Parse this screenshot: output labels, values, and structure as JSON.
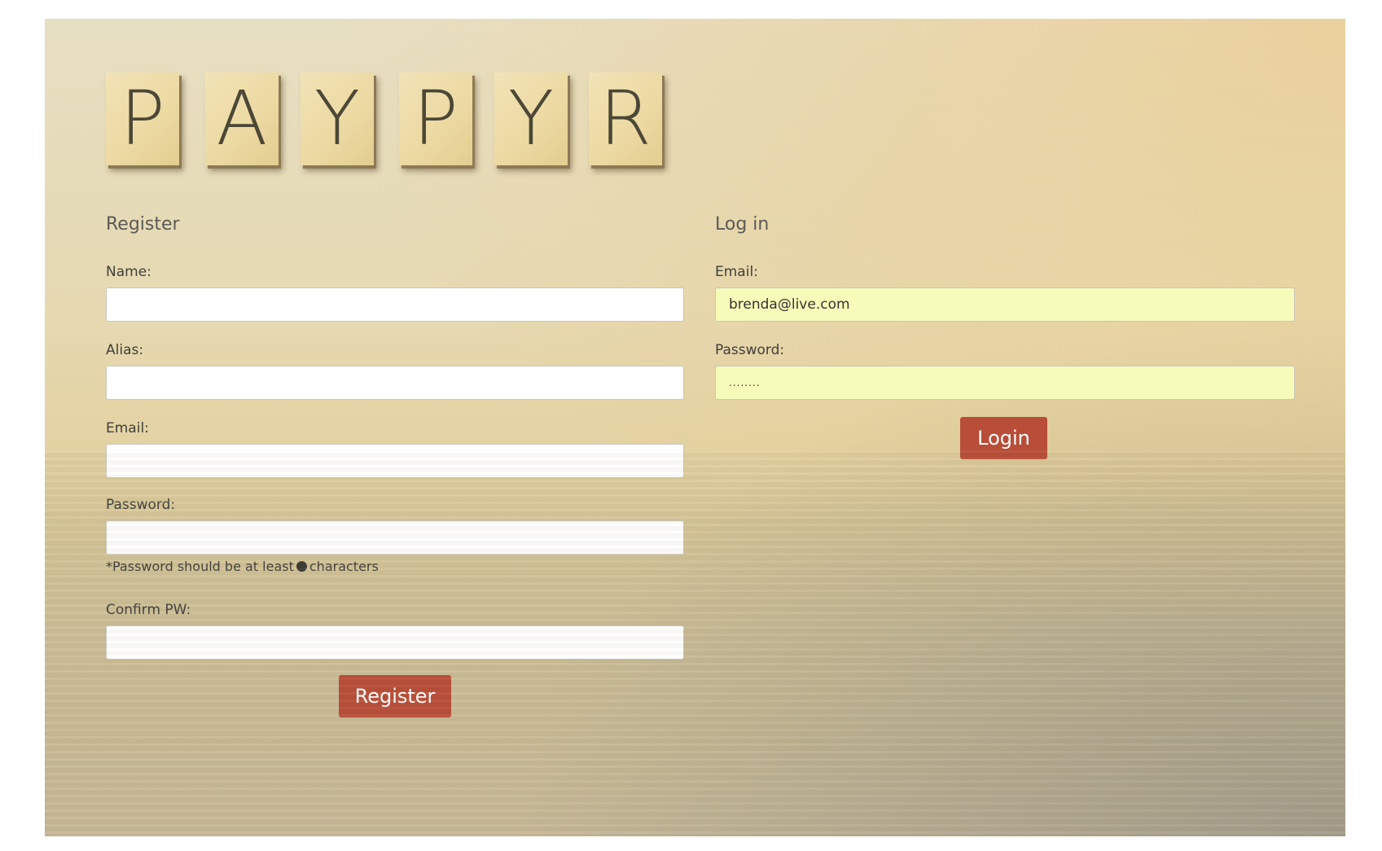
{
  "logo": {
    "letters": [
      "P",
      "A",
      "Y",
      "P",
      "Y",
      "R"
    ]
  },
  "register": {
    "title": "Register",
    "name_label": "Name:",
    "name_value": "",
    "alias_label": "Alias:",
    "alias_value": "",
    "email_label": "Email:",
    "email_value": "",
    "password_label": "Password:",
    "password_value": "",
    "password_hint_before": "*Password should be at least",
    "password_hint_after": "characters",
    "confirm_label": "Confirm PW:",
    "confirm_value": "",
    "button_label": "Register"
  },
  "login": {
    "title": "Log in",
    "email_label": "Email:",
    "email_value": "brenda@live.com",
    "password_label": "Password:",
    "password_value": "........",
    "button_label": "Login"
  },
  "colors": {
    "button": "#b84d38",
    "autofill": "#f7fbb9",
    "tile": "#ecd9a2"
  }
}
